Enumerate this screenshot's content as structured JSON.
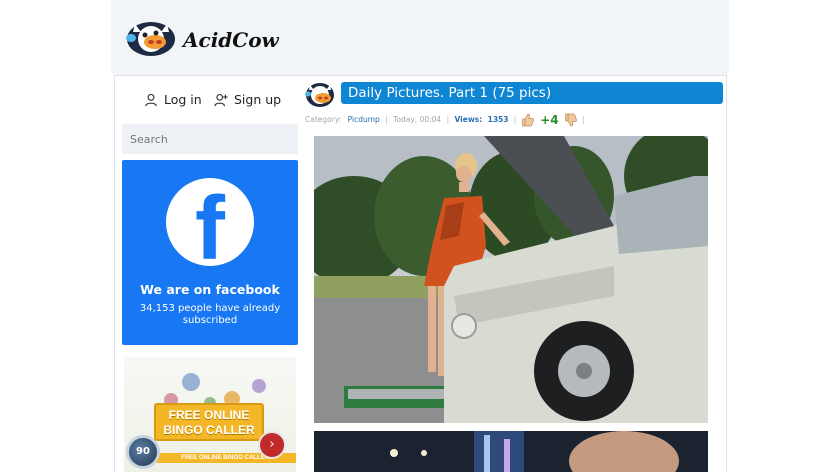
{
  "site": {
    "logo_text": "AcidCow"
  },
  "auth": {
    "login_label": "Log in",
    "signup_label": "Sign up"
  },
  "search": {
    "placeholder": "Search"
  },
  "facebook": {
    "title": "We are on facebook",
    "subtitle": "34,153 people have already subscribed",
    "brand_color": "#1877f2"
  },
  "ad": {
    "banner_text": "FREE ONLINE BINGO CALLER",
    "strip_text": "FREE ONLINE BINGO CALLER",
    "ball_number": "90",
    "next_symbol": "›"
  },
  "post": {
    "title": "Daily Pictures. Part 1 (75 pics)",
    "category_label": "Category:",
    "category": "Picdump",
    "time": "Today, 00:04",
    "views_label": "Views:",
    "views": "1353",
    "rating": "+4",
    "separator": "|"
  },
  "colors": {
    "accent": "#0e86d4",
    "rating_positive": "#2e8b2e"
  },
  "icons": [
    "user-icon",
    "user-plus-icon",
    "facebook-logo-icon",
    "thumbs-up-icon",
    "thumbs-down-icon"
  ]
}
